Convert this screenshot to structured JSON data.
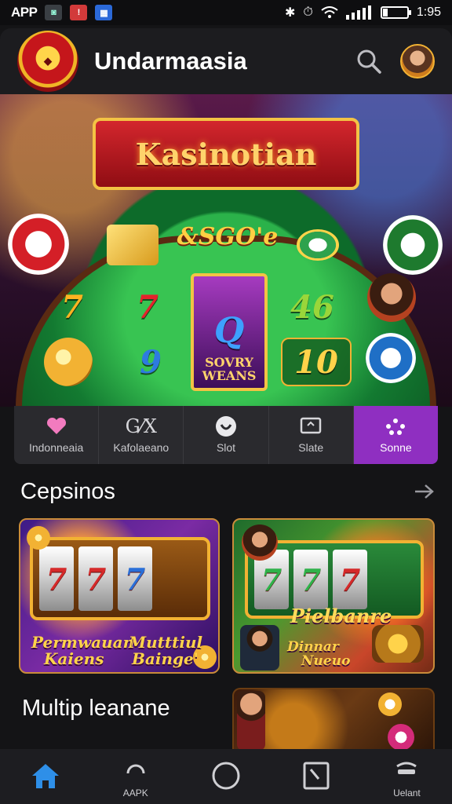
{
  "status_bar": {
    "app_label": "APP",
    "time": "1:95"
  },
  "header": {
    "title": "Undarmaasia"
  },
  "hero": {
    "banner_title": "Kasinotian",
    "subtitle": "&SGO'e",
    "symbols": [
      "7",
      "7",
      "Q",
      "46",
      "9",
      "10"
    ],
    "reel_text": "SOVRY WEANS"
  },
  "tabs": [
    {
      "label": "Indonneaia",
      "icon": "heart-icon",
      "active": false
    },
    {
      "label": "Kafolaeano",
      "icon": "gx-icon",
      "active": false
    },
    {
      "label": "Slot",
      "icon": "chip-icon",
      "active": false
    },
    {
      "label": "Slate",
      "icon": "box-icon",
      "active": false
    },
    {
      "label": "Sonne",
      "icon": "network-icon",
      "active": true
    }
  ],
  "sections": [
    {
      "title": "Cepsinos",
      "cards": [
        {
          "caption_line1": "Permwauan",
          "caption_line2": "Kaiens",
          "caption_line3": "Mutttiul",
          "caption_line4": "Bainge'"
        },
        {
          "caption_line1": "Pielbanre",
          "caption_line2": "Dinnar",
          "caption_line3": "Nueuo"
        }
      ]
    },
    {
      "title": "Multip leanane"
    }
  ],
  "bottom_nav": [
    {
      "label": "",
      "icon": "home-icon",
      "active": true
    },
    {
      "label": "AAPK",
      "icon": "refresh-icon",
      "active": false
    },
    {
      "label": "",
      "icon": "circle-icon",
      "active": false
    },
    {
      "label": "",
      "icon": "document-icon",
      "active": false
    },
    {
      "label": "Uelant",
      "icon": "wallet-icon",
      "active": false
    }
  ],
  "colors": {
    "accent": "#8f2fc1",
    "home_blue": "#2e8fe8",
    "gold": "#f2b233"
  }
}
